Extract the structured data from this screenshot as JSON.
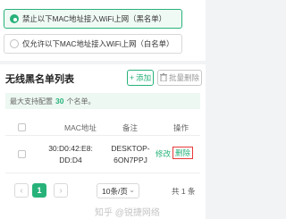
{
  "mode_options": [
    {
      "label": "禁止以下MAC地址接入WiFi上网（黑名单）",
      "selected": true
    },
    {
      "label": "仅允许以下MAC地址接入WiFi上网（白名单）",
      "selected": false
    }
  ],
  "list": {
    "title": "无线黑名单列表",
    "add_label": "添加",
    "batch_delete_label": "批量删除",
    "notice_prefix": "最大支持配置",
    "notice_count": "30",
    "notice_suffix": "个名单。"
  },
  "table": {
    "headers": {
      "mac": "MAC地址",
      "note": "备注",
      "actions": "操作"
    },
    "rows": [
      {
        "mac_line1": "30:D0:42:E8:",
        "mac_line2": "DD:D4",
        "note_line1": "DESKTOP-",
        "note_line2": "6ON7PPJ",
        "edit": "修改",
        "delete": "删除"
      }
    ]
  },
  "pagination": {
    "prev_icon": "chevron-left-icon",
    "next_icon": "chevron-right-icon",
    "current_page": "1",
    "page_size": "10条/页",
    "total": "共 1 条"
  },
  "watermark": "知乎 @锐捷网络",
  "colors": {
    "accent": "#27b27a",
    "highlight": "#e83838",
    "notice_bg": "#edf8f2"
  }
}
